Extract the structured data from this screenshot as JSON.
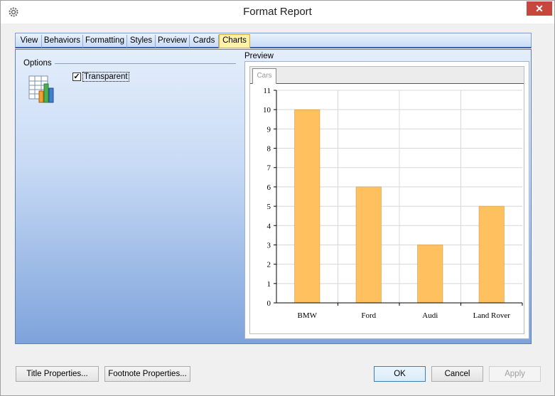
{
  "window": {
    "title": "Format Report",
    "close_glyph": "✕"
  },
  "tabs": [
    {
      "label": "View"
    },
    {
      "label": "Behaviors"
    },
    {
      "label": "Formatting"
    },
    {
      "label": "Styles"
    },
    {
      "label": "Preview"
    },
    {
      "label": "Cards"
    },
    {
      "label": "Charts",
      "active": true
    }
  ],
  "options": {
    "group_label": "Options",
    "transparent_label": "Transparent",
    "transparent_checked": true,
    "icon": "chart-table-icon"
  },
  "preview": {
    "label": "Preview",
    "chart_tab_label": "Cars"
  },
  "chart_data": {
    "type": "bar",
    "categories": [
      "BMW",
      "Ford",
      "Audi",
      "Land Rover"
    ],
    "values": [
      10,
      6,
      3,
      5
    ],
    "ylim": [
      0,
      11
    ],
    "yticks": [
      0,
      1,
      2,
      3,
      4,
      5,
      6,
      7,
      8,
      9,
      10,
      11
    ],
    "grid": true,
    "bar_color": "#ffc060",
    "bar_stroke": "#c89040"
  },
  "buttons": {
    "title_properties": "Title Properties...",
    "footnote_properties": "Footnote Properties...",
    "ok": "OK",
    "cancel": "Cancel",
    "apply": "Apply"
  },
  "colors": {
    "accent": "#3a62b4",
    "active_tab": "#fff2a8",
    "close": "#c7463d"
  }
}
